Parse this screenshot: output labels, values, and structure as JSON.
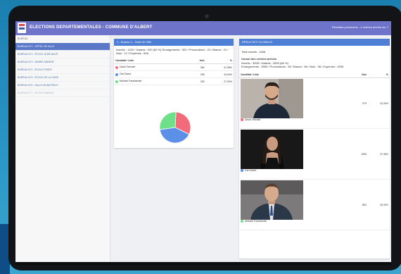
{
  "header": {
    "title": "ELECTIONS DEPARTEMENTALES - COMMUNE D'ALBERT",
    "right_text": "Résultats provisoires - 4 centres arrivés sur 7"
  },
  "sidebar": {
    "label": "BUREAU",
    "items": [
      {
        "label": "BUREAU N°1 - HÔTEL DE VILLE",
        "state": "active"
      },
      {
        "label": "BUREAU N°2 - ÉCOLE JEAN MACÉ",
        "state": "normal"
      },
      {
        "label": "BUREAU N°3 - MAIRIE ANNEXE",
        "state": "normal"
      },
      {
        "label": "BUREAU N°4 - ÉCOLE FERRY",
        "state": "normal"
      },
      {
        "label": "BUREAU N°5 - ÉCOLE DE LA GARE",
        "state": "normal"
      },
      {
        "label": "BUREAU N°6 - SALLE MUNICIPALE",
        "state": "normal"
      },
      {
        "label": "BUREAU N°7 - ÉCOLE ANNEXE",
        "state": "dim"
      }
    ]
  },
  "bureau_card": {
    "title": "1 - Bureau 1 - Hotel de Ville",
    "info": "Inscrits : 1325 / Votants : 920 (69 %) Emargements : 920 / Procurations : 23 / Blancs : 21 / Nuls : 12 / Exprimés : 848",
    "col_candidate": "Candidat / Liste",
    "col_votes": "Voix",
    "col_pct": "%",
    "rows": [
      {
        "name": "David Tennant",
        "votes": "364",
        "pct": "31,38%",
        "color": "#f26b7a"
      },
      {
        "name": "Gal Gadot",
        "votes": "338",
        "pct": "40,63%",
        "color": "#5b8fe8"
      },
      {
        "name": "Michael Fassbender",
        "votes": "303",
        "pct": "27,99%",
        "color": "#6ee08a"
      }
    ]
  },
  "chart_data": {
    "type": "pie",
    "categories": [
      "David Tennant",
      "Gal Gadot",
      "Michael Fassbender"
    ],
    "values": [
      31.38,
      40.63,
      27.99
    ],
    "colors": [
      "#f26b7a",
      "#5b8fe8",
      "#6ee08a"
    ]
  },
  "global_card": {
    "title": "RÉSULTATS GLOBAUX",
    "total": "Total inscrits : 3408",
    "subtitle": "Cumul des centres arrivés",
    "line1": "Inscrits : 3908 / Votants : 2659 (68 %)",
    "line2": "Emargements : 2659 / Procurations : 58 / Blancs : 86 / Nuls : 38 / Exprimés : 2535",
    "col_candidate": "Candidat / Liste",
    "col_votes": "Voix",
    "col_pct": "%",
    "rows": [
      {
        "name": "David Tennant",
        "votes": "979",
        "pct": "32,09%",
        "color": "#f26b7a",
        "photo": "man-beard"
      },
      {
        "name": "Gal Gadot",
        "votes": "1059",
        "pct": "37,48%",
        "color": "#5b8fe8",
        "photo": "woman-dark-hair"
      },
      {
        "name": "Michael Fassbender",
        "votes": "862",
        "pct": "30,43%",
        "color": "#6ee08a",
        "photo": "man-suit"
      }
    ]
  }
}
